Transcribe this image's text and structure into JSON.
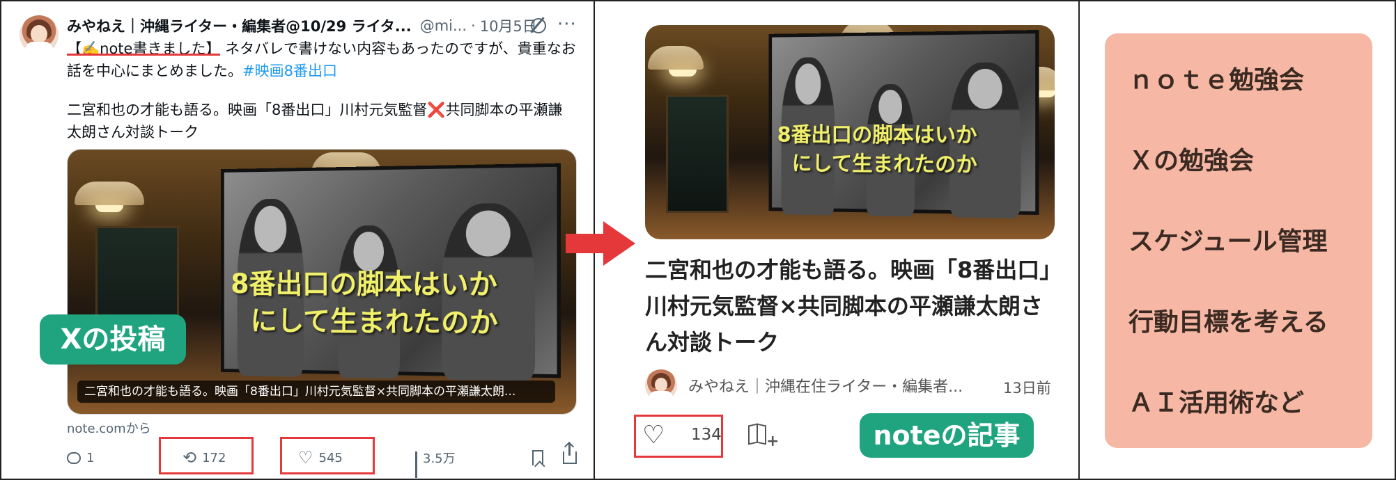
{
  "post": {
    "author_name": "みやねえ｜沖縄ライター・編集者@10/29 ライタ...",
    "handle": "@mi...",
    "separator": "·",
    "date": "10月5日",
    "more_glyph": "···",
    "text_highlight": "【✍️note書きました】",
    "text_line1_rest": "ネタバレで書けない内容もあったのですが、貴重なお",
    "text_line2_prefix": "話を中心にまとめました。",
    "hashtag": "#映画8番出口",
    "text_line3": "二宮和也の才能も語る。映画「8番出口」川村元気監督❌共同脚本の平瀬謙",
    "text_line4": "太朗さん対談トーク",
    "card_caption": "二宮和也の才能も語る。映画「8番出口」川村元気監督×共同脚本の平瀬謙太朗...",
    "source": "note.comから",
    "stats": {
      "replies": "1",
      "reposts": "172",
      "likes": "545",
      "views": "3.5万"
    }
  },
  "image": {
    "screen_line1": "8番出口の脚本はいか",
    "screen_line2": "にして生まれたのか"
  },
  "labels": {
    "x_post": "Xの投稿",
    "note_article": "noteの記事"
  },
  "article": {
    "title_line1": "二宮和也の才能も語る。映画「8番出口」",
    "title_line2": "川村元気監督×共同脚本の平瀬謙太朗さ",
    "title_line3": "ん対談トーク",
    "author": "みやねえ｜沖縄在住ライター・編集者...",
    "time": "13日前",
    "likes": "134",
    "heart_glyph": "♡"
  },
  "topics": [
    "ｎｏｔｅ勉強会",
    "Ｘの勉強会",
    "スケジュール管理",
    "行動目標を考える",
    "ＡＩ活用術など"
  ],
  "colors": {
    "accent_red": "#e5383b",
    "label_green": "#1fa47f",
    "topic_bg": "#f6b7a4",
    "link_blue": "#1d9bf0"
  }
}
